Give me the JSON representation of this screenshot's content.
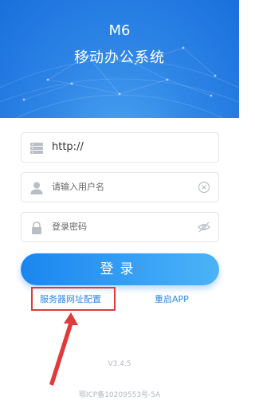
{
  "header": {
    "title": "M6",
    "subtitle": "移动办公系统"
  },
  "form": {
    "server_field": {
      "value": "http://",
      "icon": "server-icon"
    },
    "username_field": {
      "placeholder": "请输入用户名",
      "icon": "user-icon",
      "action_icon": "clear-icon"
    },
    "password_field": {
      "placeholder": "登录密码",
      "icon": "lock-icon",
      "action_icon": "eye-icon"
    },
    "login_label": "登录"
  },
  "links": {
    "server_config": "服务器网址配置",
    "restart_app": "重启APP"
  },
  "footer": {
    "version": "V3.4.5",
    "icp": "鄂ICP备10209553号-5A"
  },
  "colors": {
    "accent": "#2d86ea",
    "highlight": "#e03a3a"
  }
}
